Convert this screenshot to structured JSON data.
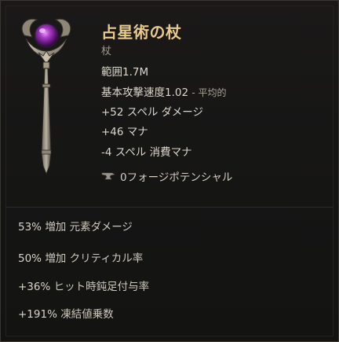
{
  "item": {
    "name": "占星術の杖",
    "type": "杖"
  },
  "stats": {
    "range_label": "範囲",
    "range_value": "1.7M",
    "speed_label": "基本攻撃速度",
    "speed_value": "1.02",
    "speed_note": "- 平均的",
    "spell_damage": "+52 スペル ダメージ",
    "mana": "+46 マナ",
    "mana_cost": "-4 スペル 消費マナ"
  },
  "forge": {
    "icon": "anvil-icon",
    "label": "0フォージポテンシャル"
  },
  "affixes": [
    {
      "value": "53%",
      "text": "増加 元素ダメージ"
    },
    {
      "value": "50%",
      "text": "増加 クリティカル率"
    },
    {
      "value": "+36%",
      "text": "ヒット時鈍足付与率"
    },
    {
      "value": "+191%",
      "text": "凍結値乗数"
    }
  ],
  "colors": {
    "name": "#e7c98d",
    "orb": "#8a2aa8",
    "background": "#161615"
  }
}
